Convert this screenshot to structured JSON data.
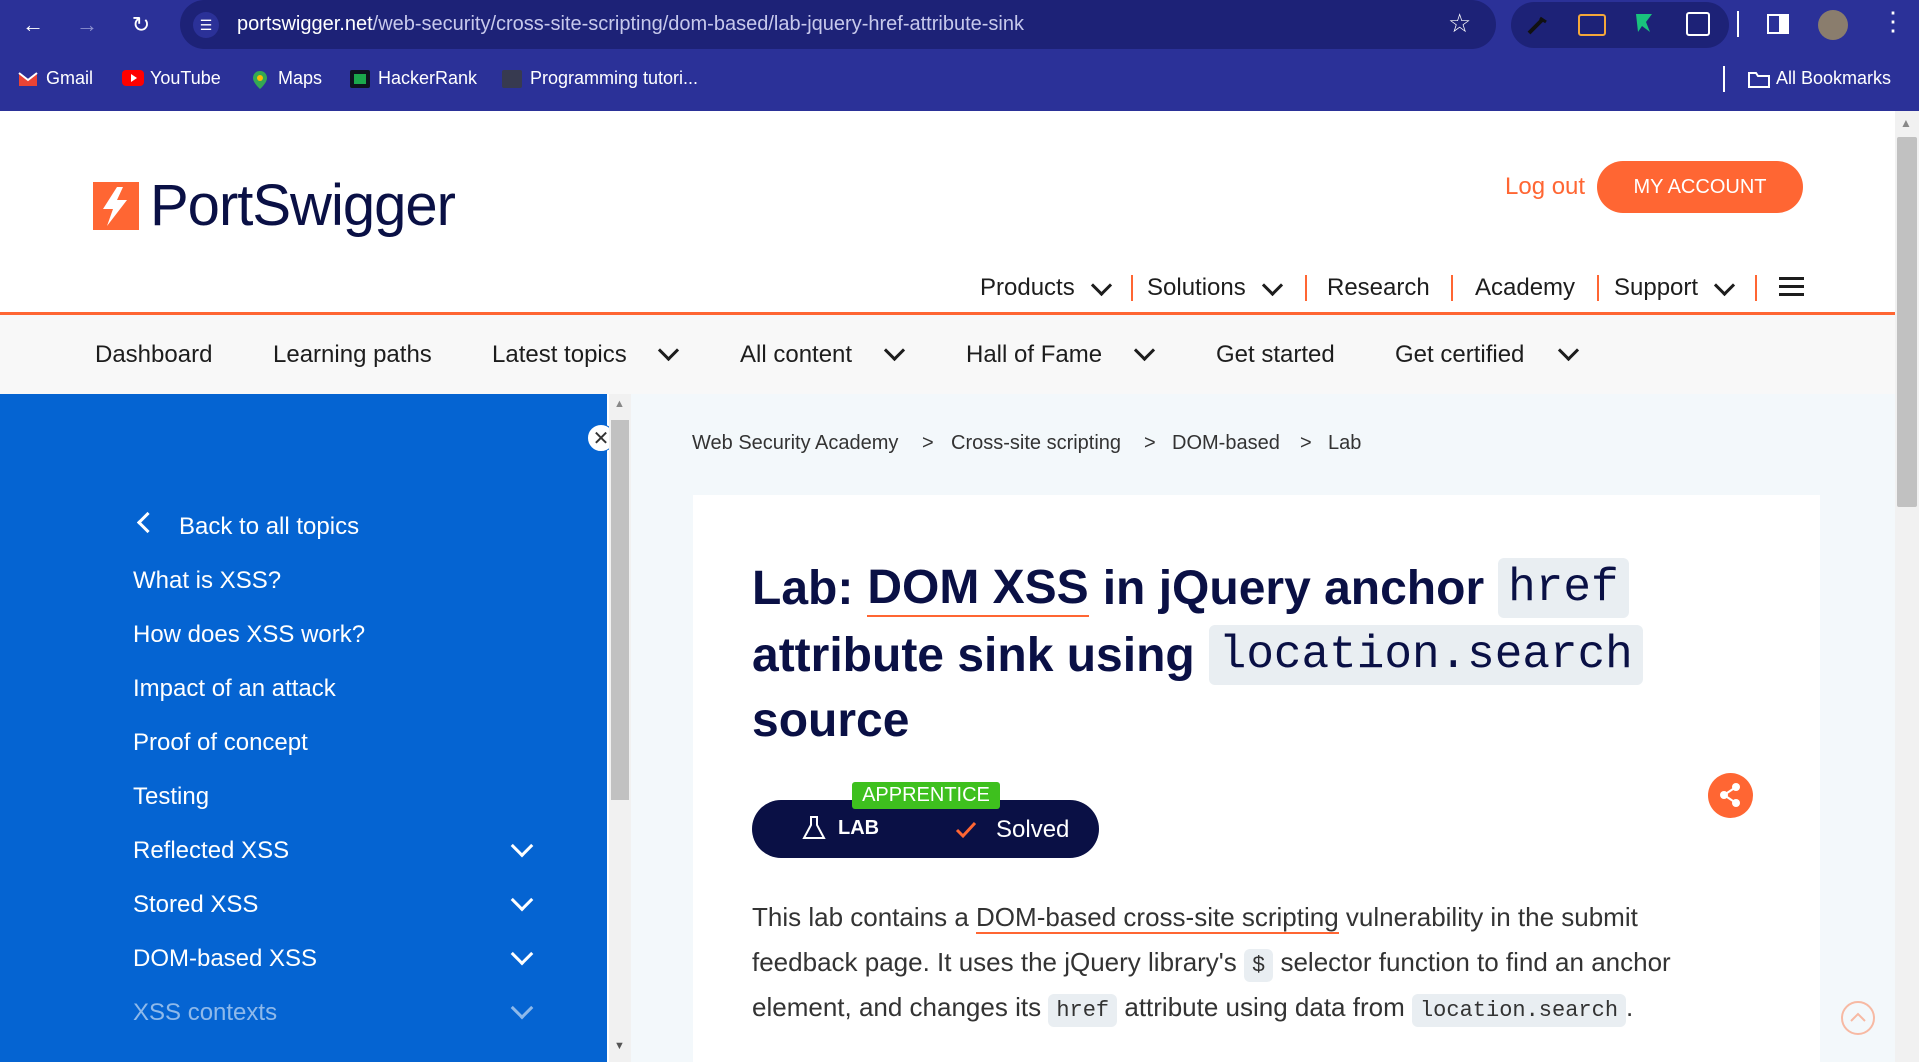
{
  "browser": {
    "url_host": "portswigger.net",
    "url_path": "/web-security/cross-site-scripting/dom-based/lab-jquery-href-attribute-sink",
    "bookmarks": [
      "Gmail",
      "YouTube",
      "Maps",
      "HackerRank",
      "Programming tutori..."
    ],
    "all_bookmarks": "All Bookmarks"
  },
  "header": {
    "logo": "PortSwigger",
    "logout": "Log out",
    "account": "MY ACCOUNT",
    "nav": [
      "Products",
      "Solutions",
      "Research",
      "Academy",
      "Support"
    ]
  },
  "subnav": [
    "Dashboard",
    "Learning paths",
    "Latest topics",
    "All content",
    "Hall of Fame",
    "Get started",
    "Get certified"
  ],
  "sidebar": {
    "back": "Back to all topics",
    "items": [
      "What is XSS?",
      "How does XSS work?",
      "Impact of an attack",
      "Proof of concept",
      "Testing",
      "Reflected XSS",
      "Stored XSS",
      "DOM-based XSS",
      "XSS contexts"
    ]
  },
  "breadcrumb": [
    "Web Security Academy",
    "Cross-site scripting",
    "DOM-based",
    "Lab"
  ],
  "breadcrumb_sep": ">",
  "lab": {
    "title_prefix": "Lab:",
    "title_link": "DOM XSS",
    "title_mid": "in jQuery anchor",
    "title_code1": "href",
    "title_line2": "attribute sink using",
    "title_code2": "location.search",
    "title_line3": "source",
    "level": "APPRENTICE",
    "badge_lab": "LAB",
    "badge_status": "Solved",
    "para_1a": "This lab contains a",
    "para_1link": "DOM-based cross-site scripting",
    "para_1b": "vulnerability in the submit",
    "para_2a": "feedback page. It uses the jQuery library's",
    "para_2code": "$",
    "para_2b": "selector function to find an anchor",
    "para_3a": "element, and changes its",
    "para_3code": "href",
    "para_3b": "attribute using data from",
    "para_3code2": "location.search",
    "para_3c": "."
  },
  "colors": {
    "brand_orange": "#ff6633",
    "sidebar_blue": "#0564d2",
    "title_navy": "#0a1045",
    "chrome": "#2b3198"
  }
}
